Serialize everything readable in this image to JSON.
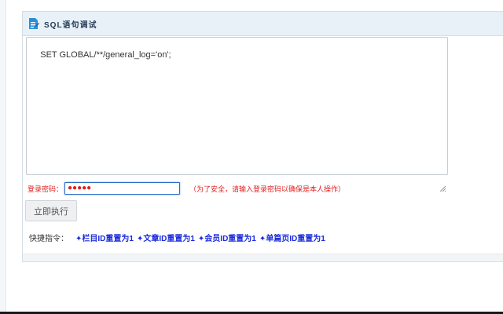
{
  "panel": {
    "title": "SQL语句调试",
    "title_icon": "edit-document-icon"
  },
  "sql_editor": {
    "value": "SET GLOBAL/**/general_log='on';"
  },
  "password": {
    "label": "登录密码：",
    "masked_value": "●●●●●",
    "hint": "（为了安全，请输入登录密码以确保是本人操作）"
  },
  "execute_button": {
    "label": "立即执行"
  },
  "shortcuts": {
    "label": "快捷指令：",
    "items": [
      {
        "label": "✦栏目ID重置为1"
      },
      {
        "label": "✦文章ID重置为1"
      },
      {
        "label": "✦会员ID重置为1"
      },
      {
        "label": "✦单篇页ID重置为1"
      }
    ]
  },
  "colors": {
    "header_bg": "#e9f1f8",
    "warning": "#e02020",
    "link": "#1b2bdc",
    "focus_border": "#2b6fc9"
  }
}
